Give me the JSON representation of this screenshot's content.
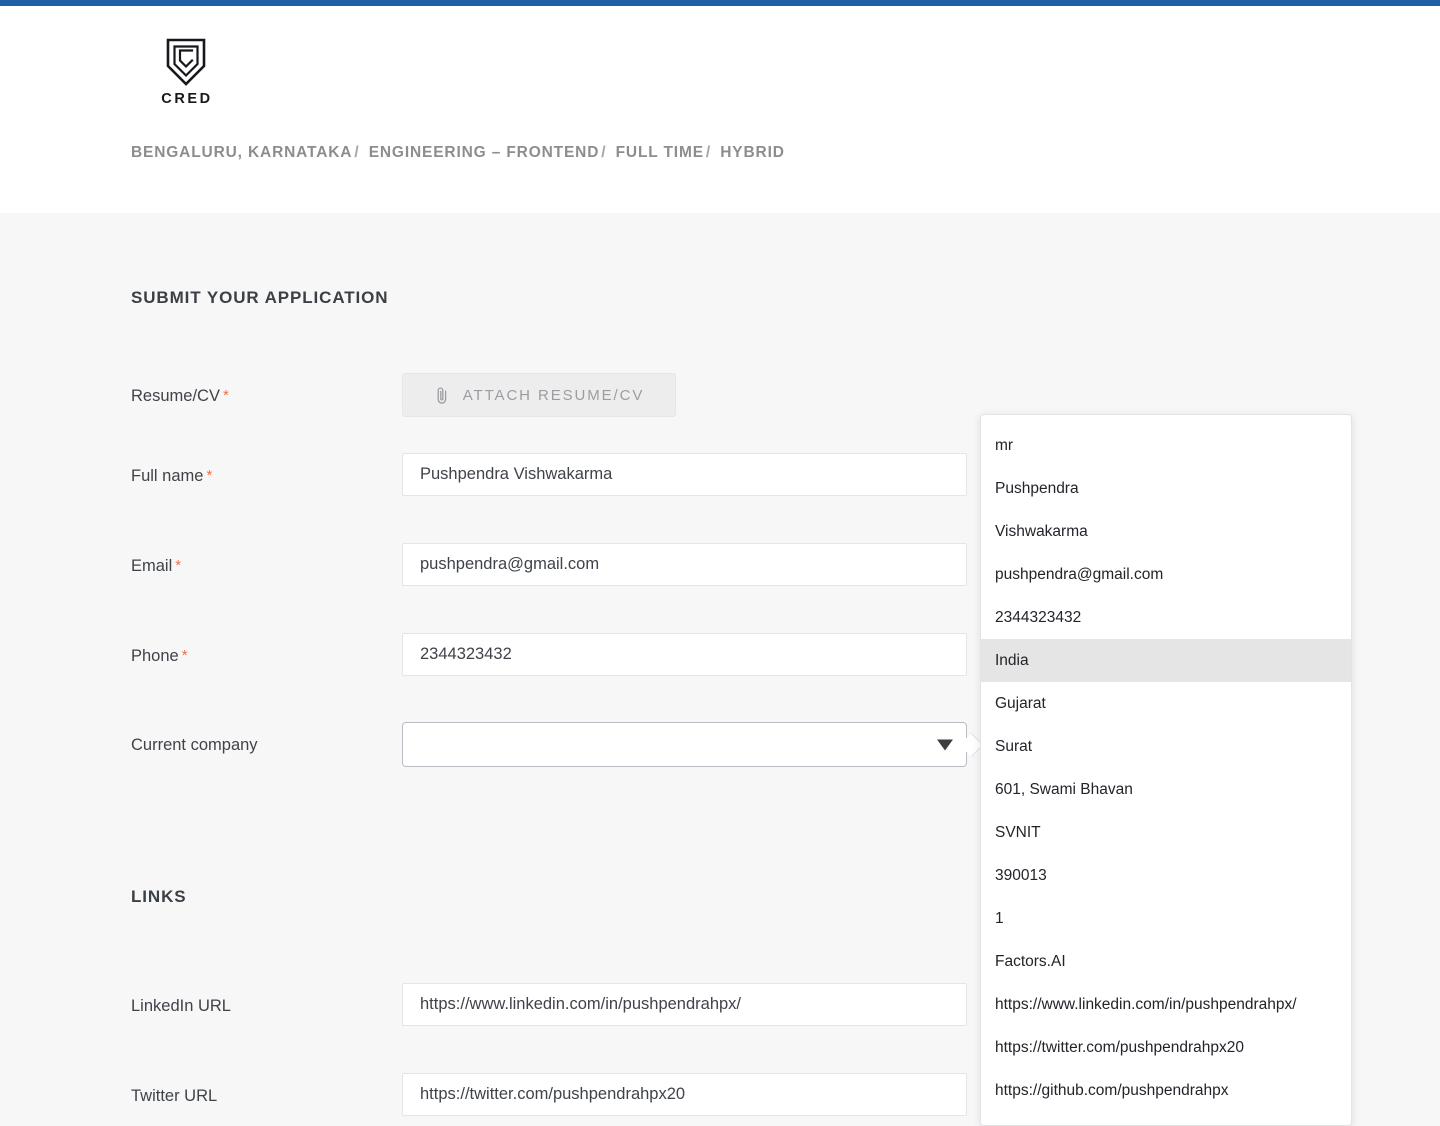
{
  "theme": {
    "accent_bar": "#1f5fa4",
    "required_asterisk": "#ef6f4b",
    "page_background": "#f7f7f7",
    "header_background": "#ffffff",
    "autofill_highlight": "#e5e5e5"
  },
  "header": {
    "logo_word": "CRED",
    "logo_icon": "cred-shield-icon",
    "breadcrumb": [
      "BENGALURU, KARNATAKA",
      "ENGINEERING – FRONTEND",
      "FULL TIME",
      "HYBRID"
    ],
    "breadcrumb_separator": "/"
  },
  "form": {
    "application_section_title": "SUBMIT YOUR APPLICATION",
    "links_section_title": "LINKS",
    "resume": {
      "label": "Resume/CV",
      "required": true,
      "button_label": "ATTACH RESUME/CV",
      "button_icon": "paperclip-icon"
    },
    "fields": [
      {
        "label": "Full name",
        "required": true,
        "value": "Pushpendra Vishwakarma",
        "placeholder": ""
      },
      {
        "label": "Email",
        "required": true,
        "value": "pushpendra@gmail.com",
        "placeholder": ""
      },
      {
        "label": "Phone",
        "required": true,
        "value": "2344323432",
        "placeholder": ""
      },
      {
        "label": "Current company",
        "required": false,
        "value": "",
        "placeholder": ""
      }
    ],
    "links": [
      {
        "label": "LinkedIn URL",
        "required": false,
        "value": "https://www.linkedin.com/in/pushpendrahpx/",
        "placeholder": ""
      },
      {
        "label": "Twitter URL",
        "required": false,
        "value": "https://twitter.com/pushpendrahpx20",
        "placeholder": ""
      }
    ]
  },
  "autofill": {
    "selected_index": 5,
    "items": [
      "mr",
      "Pushpendra",
      "Vishwakarma",
      "pushpendra@gmail.com",
      "2344323432",
      "India",
      "Gujarat",
      "Surat",
      "601, Swami Bhavan",
      "SVNIT",
      "390013",
      "1",
      "Factors.AI",
      "https://www.linkedin.com/in/pushpendrahpx/",
      "https://twitter.com/pushpendrahpx20",
      "https://github.com/pushpendrahpx"
    ]
  }
}
